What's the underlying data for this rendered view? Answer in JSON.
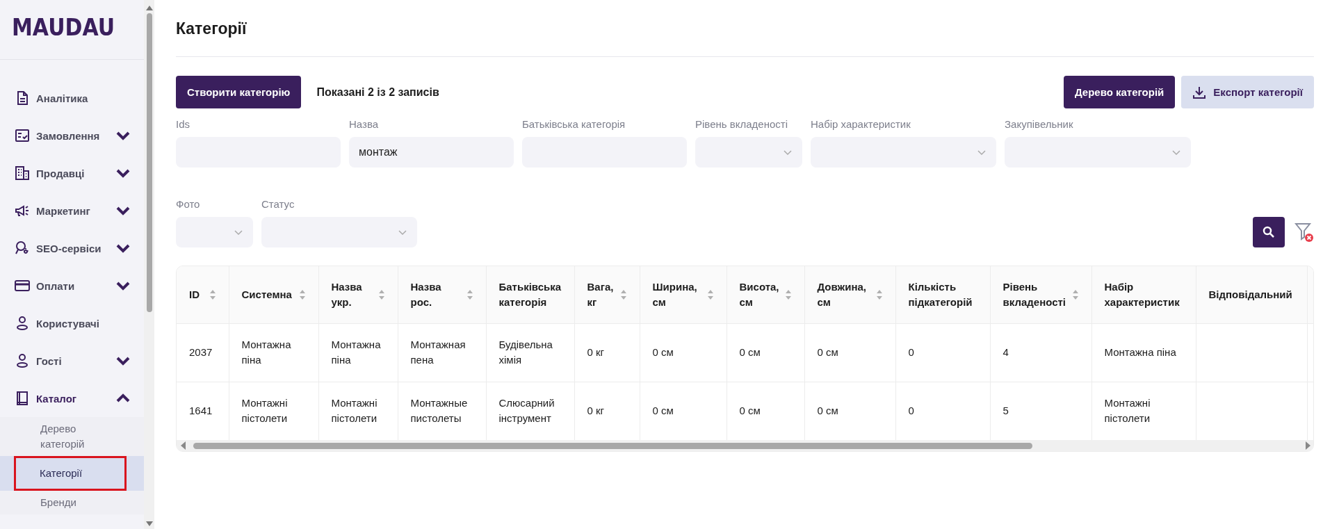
{
  "logo": "MAUDAU",
  "sidebar": {
    "items": [
      {
        "label": "Аналітика"
      },
      {
        "label": "Замовлення",
        "expanded": false
      },
      {
        "label": "Продавці",
        "expanded": false
      },
      {
        "label": "Маркетинг",
        "expanded": false
      },
      {
        "label": "SEO-сервіси",
        "expanded": false
      },
      {
        "label": "Оплати",
        "expanded": false
      },
      {
        "label": "Користувачі"
      },
      {
        "label": "Гості",
        "expanded": false
      },
      {
        "label": "Каталог",
        "expanded": true,
        "children": [
          {
            "label": "Дерево категорій",
            "selected": false
          },
          {
            "label": "Категорії",
            "selected": true
          },
          {
            "label": "Бренди",
            "selected": false
          }
        ]
      }
    ]
  },
  "page_title": "Категорії",
  "toolbar": {
    "create_button": "Створити категорію",
    "records_info": "Показані 2 із 2 записів",
    "tree_button": "Дерево категорій",
    "export_button": "Експорт категорії"
  },
  "filters": [
    {
      "label": "Ids",
      "kind": "text"
    },
    {
      "label": "Назва",
      "kind": "text",
      "value": "монтаж"
    },
    {
      "label": "Батьківська категорія",
      "kind": "text"
    },
    {
      "label": "Рівень вкладеності",
      "kind": "select"
    },
    {
      "label": "Набір характеристик",
      "kind": "select"
    },
    {
      "label": "Закупівельник",
      "kind": "select"
    },
    {
      "label": "Фото",
      "kind": "select"
    },
    {
      "label": "Статус",
      "kind": "select"
    }
  ],
  "table": {
    "columns": [
      {
        "label": "ID",
        "sortable": true
      },
      {
        "label": "Системна",
        "sortable": true
      },
      {
        "label": "Назва укр.",
        "sortable": true
      },
      {
        "label": "Назва рос.",
        "sortable": true
      },
      {
        "label": "Батьківська категорія",
        "sortable": false
      },
      {
        "label": "Вага, кг",
        "sortable": true
      },
      {
        "label": "Ширина, см",
        "sortable": true
      },
      {
        "label": "Висота, см",
        "sortable": true
      },
      {
        "label": "Довжина, см",
        "sortable": true
      },
      {
        "label": "Кількість підкатегорій",
        "sortable": false
      },
      {
        "label": "Рівень вкладеності",
        "sortable": true
      },
      {
        "label": "Набір характеристик",
        "sortable": false
      },
      {
        "label": "Відповідальний",
        "sortable": false
      }
    ],
    "rows": [
      {
        "cells": [
          "2037",
          "Монтажна піна",
          "Монтажна піна",
          "Монтажная пена",
          "Будівельна хімія",
          "0 кг",
          "0 см",
          "0 см",
          "0 см",
          "0",
          "4",
          "Монтажна піна"
        ]
      },
      {
        "cells": [
          "1641",
          "Монтажні пістолети",
          "Монтажні пістолети",
          "Монтажные пистолеты",
          "Слюсарний інструмент",
          "0 кг",
          "0 см",
          "0 см",
          "0 см",
          "0",
          "5",
          "Монтажні пістолети"
        ]
      }
    ]
  }
}
